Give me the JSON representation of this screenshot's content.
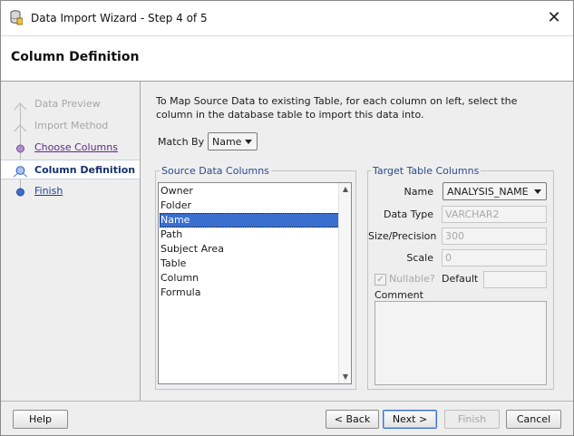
{
  "window": {
    "title": "Data Import Wizard - Step 4 of 5",
    "close_glyph": "✕"
  },
  "header": {
    "title": "Column Definition"
  },
  "nav": {
    "items": [
      {
        "label": "Data Preview",
        "state": "disabled"
      },
      {
        "label": "Import Method",
        "state": "disabled"
      },
      {
        "label": "Choose Columns",
        "state": "visited"
      },
      {
        "label": "Column Definition",
        "state": "current"
      },
      {
        "label": "Finish",
        "state": "link"
      }
    ]
  },
  "main": {
    "intro": "To Map Source Data to existing Table, for each column on left, select the column in the database table to import this data into.",
    "match_by": {
      "label": "Match By",
      "value": "Name"
    }
  },
  "source": {
    "legend": "Source Data Columns",
    "items": [
      "Owner",
      "Folder",
      "Name",
      "Path",
      "Subject Area",
      "Table",
      "Column",
      "Formula"
    ],
    "selected_index": 2
  },
  "target": {
    "legend": "Target Table Columns",
    "name_label": "Name",
    "name_value": "ANALYSIS_NAME",
    "datatype_label": "Data Type",
    "datatype_value": "VARCHAR2",
    "size_label": "Size/Precision",
    "size_value": "300",
    "scale_label": "Scale",
    "scale_value": "0",
    "nullable_label": "Nullable?",
    "nullable_checked": true,
    "default_label": "Default",
    "default_value": "",
    "comment_label": "Comment",
    "comment_value": ""
  },
  "footer": {
    "help": "Help",
    "back": "< Back",
    "next": "Next >",
    "finish": "Finish",
    "cancel": "Cancel"
  },
  "colors": {
    "accent": "#3a6fd0",
    "legend_text": "#2a4b8d",
    "nav_current_text": "#14316e",
    "nav_visited": "#5c2a8a"
  }
}
